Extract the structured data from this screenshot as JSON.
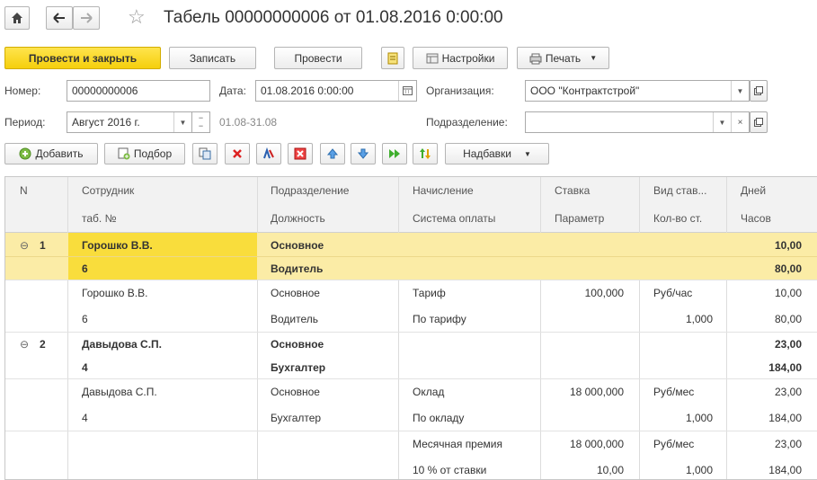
{
  "title": "Табель 00000000006 от 01.08.2016 0:00:00",
  "toolbar": {
    "post_close": "Провести и закрыть",
    "save": "Записать",
    "post": "Провести",
    "settings": "Настройки",
    "print": "Печать"
  },
  "form": {
    "number_label": "Номер:",
    "number_value": "00000000006",
    "date_label": "Дата:",
    "date_value": "01.08.2016  0:00:00",
    "org_label": "Организация:",
    "org_value": "ООО \"Контрактстрой\"",
    "period_label": "Период:",
    "period_value": "Август 2016 г.",
    "period_range": "01.08-31.08",
    "dept_label": "Подразделение:",
    "dept_value": ""
  },
  "tabletoolbar": {
    "add": "Добавить",
    "pick": "Подбор",
    "bonuses": "Надбавки"
  },
  "columns": {
    "n": "N",
    "employee": "Сотрудник",
    "tabno": "таб. №",
    "dept": "Подразделение",
    "position": "Должность",
    "accrual": "Начисление",
    "paysystem": "Система оплаты",
    "rate": "Ставка",
    "param": "Параметр",
    "ratetype": "Вид став...",
    "count": "Кол-во ст.",
    "days": "Дней",
    "hours": "Часов"
  },
  "groups": [
    {
      "n": "1",
      "name": "Горошко В.В.",
      "tabno": "6",
      "dept": "Основное",
      "position": "Водитель",
      "days": "10,00",
      "hours": "80,00",
      "lines": [
        {
          "name": "Горошко В.В.",
          "tabno": "6",
          "dept": "Основное",
          "position": "Водитель",
          "accrual": "Тариф",
          "paysystem": "По тарифу",
          "rate": "100,000",
          "param": "",
          "ratetype": "Руб/час",
          "count": "1,000",
          "days": "10,00",
          "hours": "80,00"
        }
      ]
    },
    {
      "n": "2",
      "name": "Давыдова С.П.",
      "tabno": "4",
      "dept": "Основное",
      "position": "Бухгалтер",
      "days": "23,00",
      "hours": "184,00",
      "lines": [
        {
          "name": "Давыдова С.П.",
          "tabno": "4",
          "dept": "Основное",
          "position": "Бухгалтер",
          "accrual": "Оклад",
          "paysystem": "По окладу",
          "rate": "18 000,000",
          "param": "",
          "ratetype": "Руб/мес",
          "count": "1,000",
          "days": "23,00",
          "hours": "184,00"
        },
        {
          "name": "",
          "tabno": "",
          "dept": "",
          "position": "",
          "accrual": "Месячная премия",
          "paysystem": "10 % от ставки",
          "rate": "18 000,000",
          "param": "10,00",
          "ratetype": "Руб/мес",
          "count": "1,000",
          "days": "23,00",
          "hours": "184,00"
        }
      ]
    }
  ]
}
